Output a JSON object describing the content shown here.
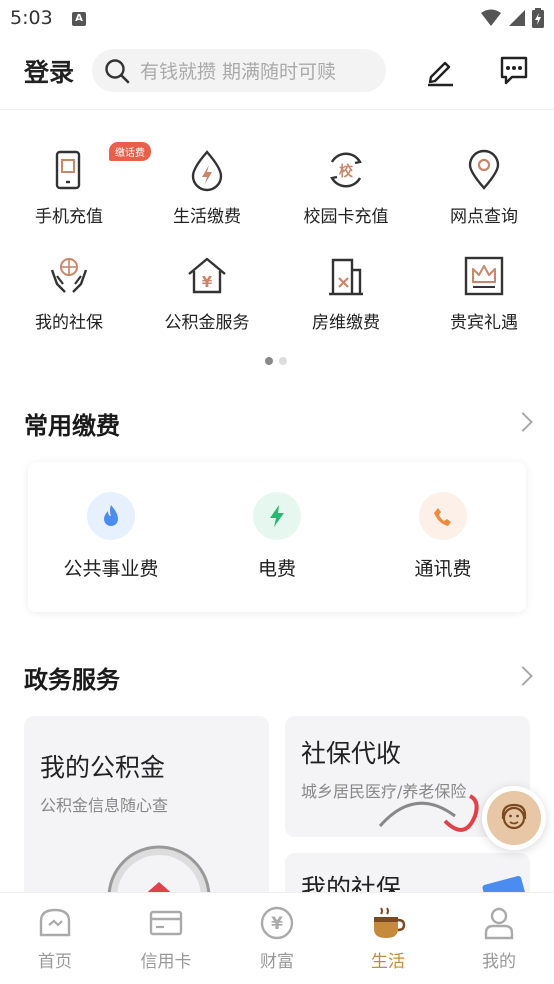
{
  "status_bar": {
    "time": "5:03",
    "notification_icon": "A"
  },
  "header": {
    "login_label": "登录",
    "search_placeholder": "有钱就攒 期满随时可赎"
  },
  "services": [
    {
      "label": "手机充值",
      "icon": "phone-recharge-icon",
      "badge": "缴话费"
    },
    {
      "label": "生活缴费",
      "icon": "lightning-drop-icon"
    },
    {
      "label": "校园卡充值",
      "icon": "campus-card-icon",
      "glyph": "校"
    },
    {
      "label": "网点查询",
      "icon": "location-pin-icon"
    },
    {
      "label": "我的社保",
      "icon": "social-security-hands-icon"
    },
    {
      "label": "公积金服务",
      "icon": "house-yuan-icon",
      "glyph": "¥"
    },
    {
      "label": "房维缴费",
      "icon": "building-repair-icon"
    },
    {
      "label": "贵宾礼遇",
      "icon": "crown-icon"
    }
  ],
  "common_pay": {
    "title": "常用缴费",
    "items": [
      {
        "label": "公共事业费",
        "icon": "flame-icon",
        "color": "#e7f0fd"
      },
      {
        "label": "电费",
        "icon": "lightning-icon",
        "color": "#e6f7f0"
      },
      {
        "label": "通讯费",
        "icon": "phone-handset-icon",
        "color": "#fdf0e8"
      }
    ]
  },
  "gov_services": {
    "title": "政务服务",
    "cards": [
      {
        "title": "我的公积金",
        "subtitle": "公积金信息随心查"
      },
      {
        "title": "社保代收",
        "subtitle": "城乡居民医疗/养老保险"
      },
      {
        "title": "我的社保",
        "subtitle": ""
      }
    ]
  },
  "tabbar": [
    {
      "label": "首页",
      "icon": "home-icon"
    },
    {
      "label": "信用卡",
      "icon": "credit-card-icon"
    },
    {
      "label": "财富",
      "icon": "yuan-coin-icon",
      "glyph": "¥"
    },
    {
      "label": "生活",
      "icon": "coffee-cup-icon",
      "active": true
    },
    {
      "label": "我的",
      "icon": "person-icon"
    }
  ],
  "colors": {
    "accent": "#c58a3c",
    "badge": "#e8604c",
    "icon_dark": "#333333"
  }
}
